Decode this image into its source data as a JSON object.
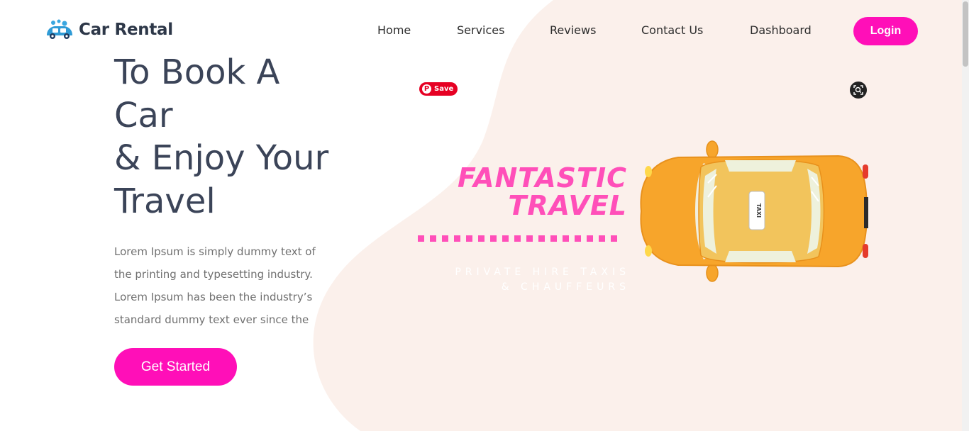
{
  "brand": {
    "name": "Car Rental",
    "accent_color": "#ff0fb8",
    "blob_color": "#fbf0eb",
    "text_color": "#3b4458"
  },
  "nav": {
    "items": [
      {
        "label": "Home"
      },
      {
        "label": "Services"
      },
      {
        "label": "Reviews"
      },
      {
        "label": "Contact Us"
      },
      {
        "label": "Dashboard"
      }
    ],
    "login_label": "Login"
  },
  "hero": {
    "title_lines": [
      "To Book A",
      "Car",
      "& Enjoy Your",
      "Travel"
    ],
    "description_lines": [
      "Lorem Ipsum is simply dummy text of",
      "the printing and typesetting industry.",
      "Lorem Ipsum has been the industry’s",
      "standard dummy text ever since the"
    ],
    "cta_label": "Get Started"
  },
  "promo": {
    "title_line1": "FANTASTIC",
    "title_line2": "TRAVEL",
    "subtitle_line1": "PRIVATE HIRE TAXIS",
    "subtitle_line2": "& CHAUFFEURS",
    "taxi_sign": "TAXI",
    "pink_color": "#ff4fb9",
    "car_color": "#f7a52b"
  },
  "overlay": {
    "pinterest_save_label": "Save",
    "pinterest_glyph": "P",
    "visual_search_icon": "lens-search-icon"
  }
}
